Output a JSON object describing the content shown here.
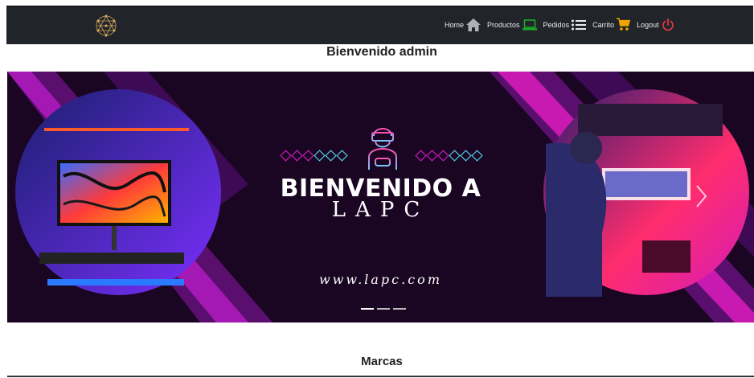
{
  "nav": {
    "home": "Home",
    "productos": "Productos",
    "pedidos": "Pedidos",
    "carrito": "Carrito",
    "logout": "Logout"
  },
  "welcome": "Bienvenido admin",
  "banner": {
    "title_line1": "BIENVENIDO A",
    "title_line2": "LAPC",
    "url": "www.lapc.com"
  },
  "carousel": {
    "slide_count": 3,
    "active_index": 0
  },
  "sections": {
    "brands_title": "Marcas"
  },
  "icons": {
    "logo": "network-logo-icon",
    "home": "house-icon",
    "productos": "laptop-icon",
    "pedidos": "list-icon",
    "carrito": "cart-icon",
    "logout": "power-icon",
    "banner": "vr-gamer-icon",
    "next": "chevron-right-icon"
  },
  "colors": {
    "navbar_bg": "#212529",
    "productos_icon": "#19a82a",
    "carrito_icon": "#f0a500",
    "logout_icon": "#dc3545",
    "banner_bg": "#1a0522",
    "banner_magenta": "#c51bb8"
  }
}
